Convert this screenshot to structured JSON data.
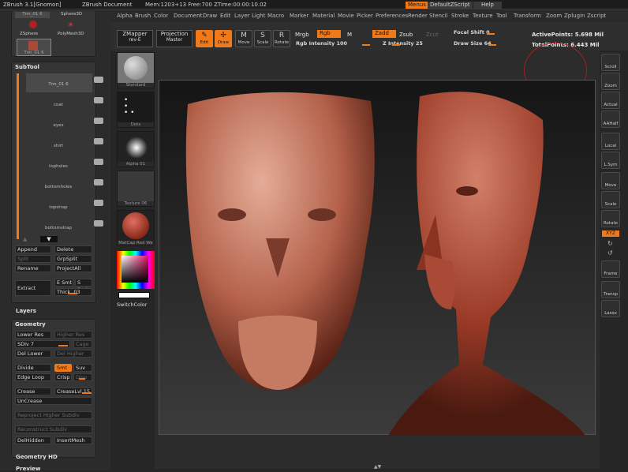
{
  "title": {
    "app": "ZBrush 3.1[Gnomon]",
    "document": "ZBrush Document",
    "mem": "Mem:1203+13 Free:700 ZTime:00:00:10.02",
    "menus_btn": "Menus",
    "script_btn": "DefaultZScript",
    "help_btn": "Help"
  },
  "menu": [
    "Alpha",
    "Brush",
    "Color",
    "Document",
    "Draw",
    "Edit",
    "Layer",
    "Light",
    "Macro",
    "Marker",
    "Material",
    "Movie",
    "Picker",
    "Preferences",
    "Render",
    "Stencil",
    "Stroke",
    "Texture",
    "Tool",
    "Transform",
    "Zoom",
    "Zplugin",
    "Zscript"
  ],
  "tools_top": {
    "item1": "Tnn_01 6",
    "item2": "Sphere3D",
    "zsphere": "ZSphere",
    "polymesh": "PolyMesh3D",
    "tnn": "Tnn_01 6"
  },
  "subtool": {
    "header": "SubTool",
    "items": [
      "Tnn_01 6",
      "coat",
      "eyes",
      "shirt",
      "topholes",
      "bottomholes",
      "topstrap",
      "bottomstrap"
    ],
    "append": "Append",
    "delete": "Delete",
    "split": "Split",
    "grpsplit": "GrpSplit",
    "rename": "Rename",
    "projectall": "ProjectAll",
    "extract": "Extract",
    "esmt": "E Smt",
    "smt": "S Smt",
    "thick": "Thick .03"
  },
  "layers": "Layers",
  "geometry": {
    "header": "Geometry",
    "lower": "Lower Res",
    "higher": "Higher Res",
    "sdiv": "SDiv 7",
    "cage": "Cage",
    "dellower": "Del Lower",
    "delhigher": "Del Higher",
    "divide": "Divide",
    "smt": "Smt",
    "suv": "Suv",
    "edgeloop": "Edge Loop",
    "crisp": "Crisp",
    "disp": "Disp",
    "crease": "Crease",
    "creaselvl": "CreaseLvl 15",
    "uncrease": "UnCrease",
    "reproject": "Reproject Higher Subdiv",
    "reconstruct": "Reconstruct Subdiv",
    "delhidden": "DelHidden",
    "insertmesh": "InsertMesh"
  },
  "geometry_hd": "Geometry HD",
  "preview": "Preview",
  "shelf": {
    "zmapper": "ZMapper",
    "zmapper_sub": "rev-E",
    "projection": "Projection",
    "projection_sub": "Master",
    "standard": "Standard",
    "dots": "Dots",
    "alpha": "Alpha 01",
    "texture": "Texture 06",
    "material": "MatCap Red Wa",
    "switchcolor": "SwitchColor"
  },
  "toolbar": {
    "edit": "Edit",
    "draw": "Draw",
    "move": "Move",
    "scale": "Scale",
    "rotate": "Rotate",
    "mrgb": "Mrgb",
    "rgb": "Rgb",
    "m": "M",
    "rgb_intensity": "Rgb Intensity 100",
    "zadd": "Zadd",
    "zsub": "Zsub",
    "zcut": "Zcut",
    "z_intensity": "Z Intensity 25",
    "focal_shift": "Focal Shift 0",
    "draw_size": "Draw Size 64",
    "active_points": "ActivePoints: 5.698 Mil",
    "total_points": "TotalPoints: 6.443 Mil"
  },
  "rightbar": [
    "Scroll",
    "Zoom",
    "Actual",
    "AAHalf",
    "Local",
    "L.Sym",
    "Move",
    "Scale",
    "Rotate",
    "XYZ",
    "",
    "Frame",
    "Transp",
    "Lasso"
  ]
}
